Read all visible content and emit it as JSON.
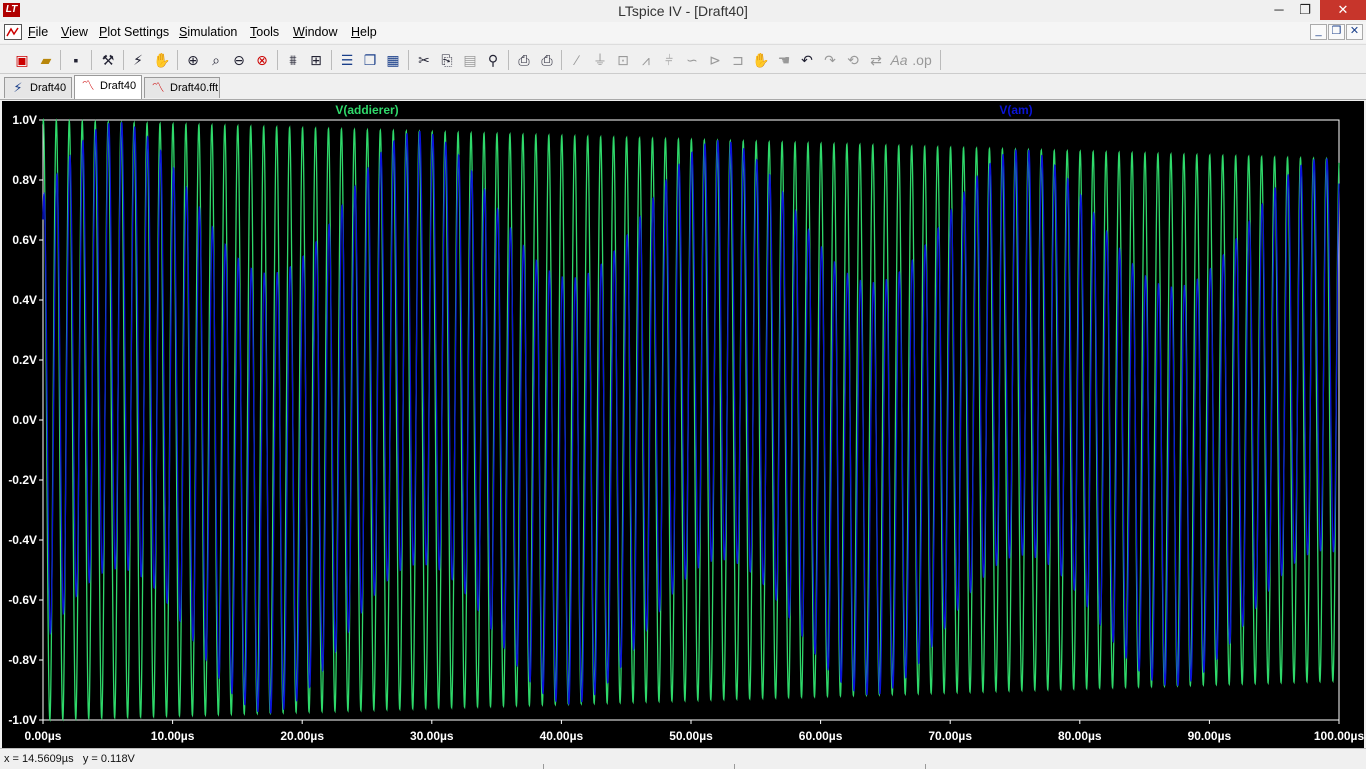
{
  "window": {
    "app_logo": "LT",
    "title": "LTspice IV - [Draft40]",
    "minimize_glyph": "─",
    "maximize_glyph": "❐",
    "close_glyph": "✕"
  },
  "menu": {
    "items": [
      {
        "label": "File",
        "key": "F",
        "rest": "ile"
      },
      {
        "label": "View",
        "key": "V",
        "rest": "iew"
      },
      {
        "label": "Plot Settings",
        "key": "P",
        "rest": "lot Settings"
      },
      {
        "label": "Simulation",
        "key": "S",
        "rest": "imulation"
      },
      {
        "label": "Tools",
        "key": "T",
        "rest": "ools"
      },
      {
        "label": "Window",
        "key": "W",
        "rest": "indow"
      },
      {
        "label": "Help",
        "key": "H",
        "rest": "elp"
      }
    ],
    "mdi_minimize_glyph": "_",
    "mdi_restore_glyph": "❐",
    "mdi_close_glyph": "✕"
  },
  "toolbar": {
    "icons": [
      "new-schematic-icon",
      "open-icon",
      "save-icon",
      "control-panel-icon",
      "run-icon",
      "halt-icon",
      "zoom-in-icon",
      "zoom-rect-icon",
      "zoom-out-icon",
      "zoom-full-icon",
      "autorange-icon",
      "grid-icon",
      "tile-horizontal-icon",
      "cascade-icon",
      "tile-icon",
      "cut-icon",
      "copy-icon",
      "paste-icon",
      "find-icon",
      "print-preview-icon",
      "print-icon",
      "wire-icon",
      "ground-icon",
      "label-icon",
      "resistor-icon",
      "capacitor-icon",
      "inductor-icon",
      "diode-icon",
      "component-icon",
      "move-icon",
      "drag-icon",
      "undo-icon",
      "redo-icon",
      "rotate-icon",
      "mirror-icon",
      "text-icon",
      "spice-directive-icon"
    ]
  },
  "tabs": [
    {
      "label": "Draft40",
      "kind": "schematic"
    },
    {
      "label": "Draft40",
      "kind": "waveform"
    },
    {
      "label": "Draft40.fft",
      "kind": "waveform"
    }
  ],
  "status": {
    "cursor_x": "x = 14.5609µs",
    "cursor_y": "y = 0.118V"
  },
  "colors": {
    "plot_background": "#000000",
    "trace_addierer": "#2fd96a",
    "trace_am": "#0a14d8",
    "axis_text": "#ffffff",
    "grid": "#ffffff"
  },
  "chart_data": {
    "type": "line",
    "series": [
      {
        "name": "V(addierer)",
        "color": "#2fd96a",
        "frequency_mhz": 1.0,
        "amplitude_start": 1.0,
        "amplitude_end": 0.87
      },
      {
        "name": "V(am)",
        "color": "#0a14d8",
        "frequency_mhz": 1.0,
        "amplitude_start": 1.0,
        "amplitude_end": 0.87,
        "modulation_depth": 0.25
      }
    ],
    "x_ticks": [
      "0.00µs",
      "10.00µs",
      "20.00µs",
      "30.00µs",
      "40.00µs",
      "50.00µs",
      "60.00µs",
      "70.00µs",
      "80.00µs",
      "90.00µs",
      "100.00µs"
    ],
    "y_ticks": [
      "1.0V",
      "0.8V",
      "0.6V",
      "0.4V",
      "0.2V",
      "0.0V",
      "-0.2V",
      "-0.4V",
      "-0.6V",
      "-0.8V",
      "-1.0V"
    ],
    "xlim": [
      0,
      100
    ],
    "ylim": [
      -1.0,
      1.0
    ],
    "x_unit": "µs",
    "y_unit": "V",
    "grid": false
  }
}
